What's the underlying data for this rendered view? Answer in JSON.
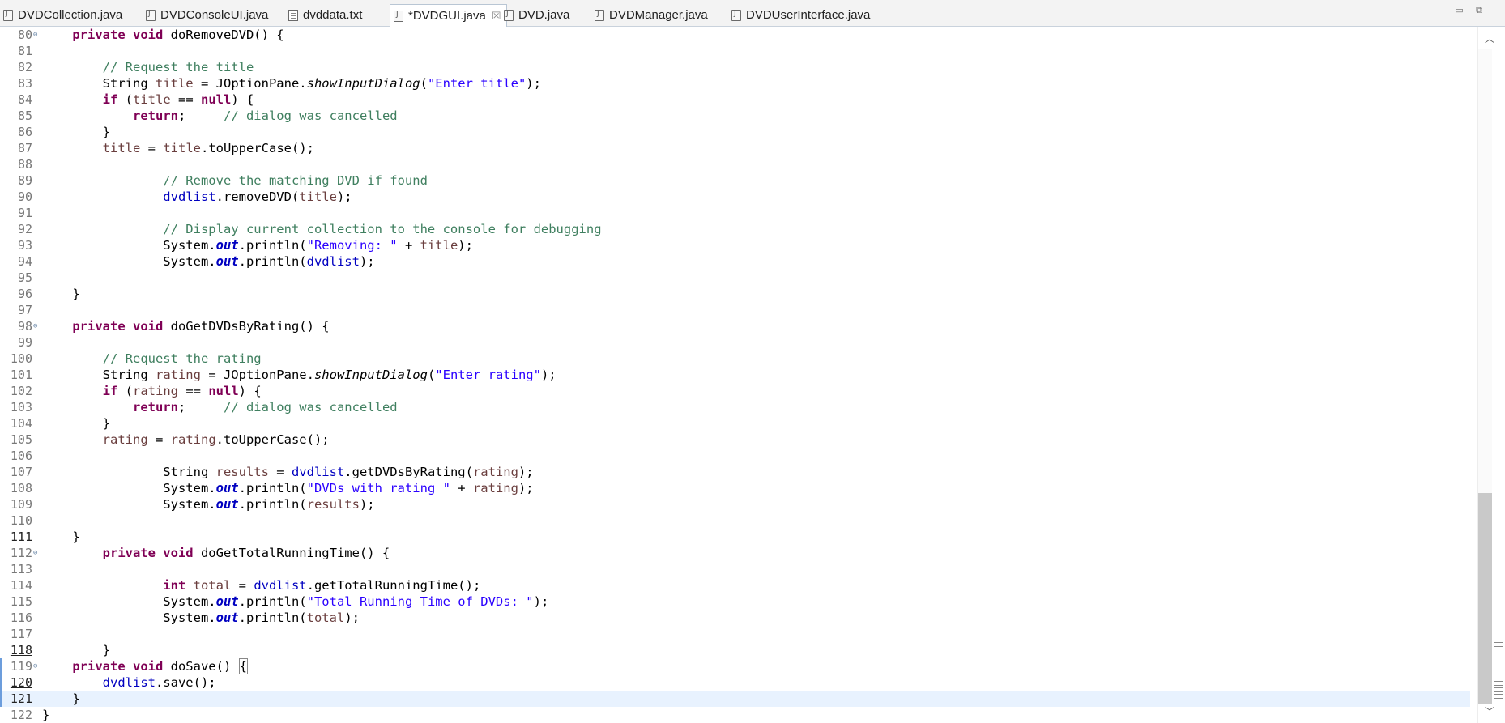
{
  "tabs": [
    {
      "label": "DVDCollection.java",
      "icon": "java-file-icon",
      "active": false
    },
    {
      "label": "DVDConsoleUI.java",
      "icon": "java-file-icon",
      "active": false
    },
    {
      "label": "dvddata.txt",
      "icon": "text-file-icon",
      "active": false
    },
    {
      "label": "*DVDGUI.java",
      "icon": "java-file-icon",
      "active": true,
      "close": "☒"
    },
    {
      "label": "DVD.java",
      "icon": "java-file-icon",
      "active": false
    },
    {
      "label": "DVDManager.java",
      "icon": "java-file-icon",
      "active": false
    },
    {
      "label": "DVDUserInterface.java",
      "icon": "java-file-icon",
      "active": false
    }
  ],
  "window_controls": "▭ ⧉",
  "editor": {
    "current_line": 121,
    "lines": [
      {
        "n": "80",
        "fold": true,
        "code": [
          [
            "kw",
            "    private void "
          ],
          [
            "",
            "doRemoveDVD() {"
          ]
        ]
      },
      {
        "n": "81",
        "code": []
      },
      {
        "n": "82",
        "code": [
          [
            "cm",
            "        // Request the title"
          ]
        ]
      },
      {
        "n": "83",
        "code": [
          [
            "",
            "        String "
          ],
          [
            "var",
            "title"
          ],
          [
            "",
            " = JOptionPane."
          ],
          [
            "it",
            "showInputDialog"
          ],
          [
            "",
            "("
          ],
          [
            "str",
            "\"Enter title\""
          ],
          [
            "",
            ");"
          ]
        ]
      },
      {
        "n": "84",
        "code": [
          [
            "kw",
            "        if"
          ],
          [
            "",
            " ("
          ],
          [
            "var",
            "title"
          ],
          [
            "",
            " == "
          ],
          [
            "kw",
            "null"
          ],
          [
            "",
            ") {"
          ]
        ]
      },
      {
        "n": "85",
        "code": [
          [
            "kw",
            "            return"
          ],
          [
            "",
            ";     "
          ],
          [
            "cm",
            "// dialog was cancelled"
          ]
        ]
      },
      {
        "n": "86",
        "code": [
          [
            "",
            "        }"
          ]
        ]
      },
      {
        "n": "87",
        "code": [
          [
            "var",
            "        title"
          ],
          [
            "",
            " = "
          ],
          [
            "var",
            "title"
          ],
          [
            "",
            ".toUpperCase();"
          ]
        ]
      },
      {
        "n": "88",
        "code": []
      },
      {
        "n": "89",
        "code": [
          [
            "cm",
            "                // Remove the matching DVD if found"
          ]
        ]
      },
      {
        "n": "90",
        "code": [
          [
            "fld",
            "                dvdlist"
          ],
          [
            "",
            ".removeDVD("
          ],
          [
            "var",
            "title"
          ],
          [
            "",
            ");"
          ]
        ]
      },
      {
        "n": "91",
        "code": []
      },
      {
        "n": "92",
        "code": [
          [
            "cm",
            "                // Display current collection to the console for debugging"
          ]
        ]
      },
      {
        "n": "93",
        "code": [
          [
            "",
            "                System."
          ],
          [
            "st",
            "out"
          ],
          [
            "",
            ".println("
          ],
          [
            "str",
            "\"Removing: \""
          ],
          [
            "",
            " + "
          ],
          [
            "var",
            "title"
          ],
          [
            "",
            ");"
          ]
        ]
      },
      {
        "n": "94",
        "code": [
          [
            "",
            "                System."
          ],
          [
            "st",
            "out"
          ],
          [
            "",
            ".println("
          ],
          [
            "fld",
            "dvdlist"
          ],
          [
            "",
            ");"
          ]
        ]
      },
      {
        "n": "95",
        "code": []
      },
      {
        "n": "96",
        "code": [
          [
            "",
            "    }"
          ]
        ]
      },
      {
        "n": "97",
        "code": []
      },
      {
        "n": "98",
        "fold": true,
        "code": [
          [
            "kw",
            "    private void "
          ],
          [
            "",
            "doGetDVDsByRating() {"
          ]
        ]
      },
      {
        "n": "99",
        "code": []
      },
      {
        "n": "100",
        "code": [
          [
            "cm",
            "        // Request the rating"
          ]
        ]
      },
      {
        "n": "101",
        "code": [
          [
            "",
            "        String "
          ],
          [
            "var",
            "rating"
          ],
          [
            "",
            " = JOptionPane."
          ],
          [
            "it",
            "showInputDialog"
          ],
          [
            "",
            "("
          ],
          [
            "str",
            "\"Enter rating\""
          ],
          [
            "",
            ");"
          ]
        ]
      },
      {
        "n": "102",
        "code": [
          [
            "kw",
            "        if"
          ],
          [
            "",
            " ("
          ],
          [
            "var",
            "rating"
          ],
          [
            "",
            " == "
          ],
          [
            "kw",
            "null"
          ],
          [
            "",
            ") {"
          ]
        ]
      },
      {
        "n": "103",
        "code": [
          [
            "kw",
            "            return"
          ],
          [
            "",
            ";     "
          ],
          [
            "cm",
            "// dialog was cancelled"
          ]
        ]
      },
      {
        "n": "104",
        "code": [
          [
            "",
            "        }"
          ]
        ]
      },
      {
        "n": "105",
        "code": [
          [
            "var",
            "        rating"
          ],
          [
            "",
            " = "
          ],
          [
            "var",
            "rating"
          ],
          [
            "",
            ".toUpperCase();"
          ]
        ]
      },
      {
        "n": "106",
        "code": []
      },
      {
        "n": "107",
        "code": [
          [
            "",
            "                String "
          ],
          [
            "var",
            "results"
          ],
          [
            "",
            " = "
          ],
          [
            "fld",
            "dvdlist"
          ],
          [
            "",
            ".getDVDsByRating("
          ],
          [
            "var",
            "rating"
          ],
          [
            "",
            ");"
          ]
        ]
      },
      {
        "n": "108",
        "code": [
          [
            "",
            "                System."
          ],
          [
            "st",
            "out"
          ],
          [
            "",
            ".println("
          ],
          [
            "str",
            "\"DVDs with rating \""
          ],
          [
            "",
            " + "
          ],
          [
            "var",
            "rating"
          ],
          [
            "",
            ");"
          ]
        ]
      },
      {
        "n": "109",
        "code": [
          [
            "",
            "                System."
          ],
          [
            "st",
            "out"
          ],
          [
            "",
            ".println("
          ],
          [
            "var",
            "results"
          ],
          [
            "",
            ");"
          ]
        ]
      },
      {
        "n": "110",
        "code": []
      },
      {
        "n": "111",
        "ul": true,
        "code": [
          [
            "",
            "    }"
          ]
        ]
      },
      {
        "n": "112",
        "fold": true,
        "code": [
          [
            "kw",
            "        private void "
          ],
          [
            "",
            "doGetTotalRunningTime() {"
          ]
        ]
      },
      {
        "n": "113",
        "code": []
      },
      {
        "n": "114",
        "code": [
          [
            "kw",
            "                int "
          ],
          [
            "var",
            "total"
          ],
          [
            "",
            " = "
          ],
          [
            "fld",
            "dvdlist"
          ],
          [
            "",
            ".getTotalRunningTime();"
          ]
        ]
      },
      {
        "n": "115",
        "code": [
          [
            "",
            "                System."
          ],
          [
            "st",
            "out"
          ],
          [
            "",
            ".println("
          ],
          [
            "str",
            "\"Total Running Time of DVDs: \""
          ],
          [
            "",
            ");"
          ]
        ]
      },
      {
        "n": "116",
        "code": [
          [
            "",
            "                System."
          ],
          [
            "st",
            "out"
          ],
          [
            "",
            ".println("
          ],
          [
            "var",
            "total"
          ],
          [
            "",
            ");"
          ]
        ]
      },
      {
        "n": "117",
        "code": []
      },
      {
        "n": "118",
        "ul": true,
        "code": [
          [
            "",
            "        }"
          ]
        ]
      },
      {
        "n": "119",
        "fold": true,
        "marker": true,
        "code": [
          [
            "kw",
            "    private void "
          ],
          [
            "",
            "doSave() "
          ],
          [
            "box",
            "{"
          ]
        ]
      },
      {
        "n": "120",
        "ul": true,
        "marker": true,
        "code": [
          [
            "fld",
            "        dvdlist"
          ],
          [
            "",
            ".save();"
          ]
        ]
      },
      {
        "n": "121",
        "ul": true,
        "marker": true,
        "code": [
          [
            "",
            "    }"
          ]
        ]
      },
      {
        "n": "122",
        "code": [
          [
            "",
            "}"
          ]
        ]
      }
    ]
  }
}
